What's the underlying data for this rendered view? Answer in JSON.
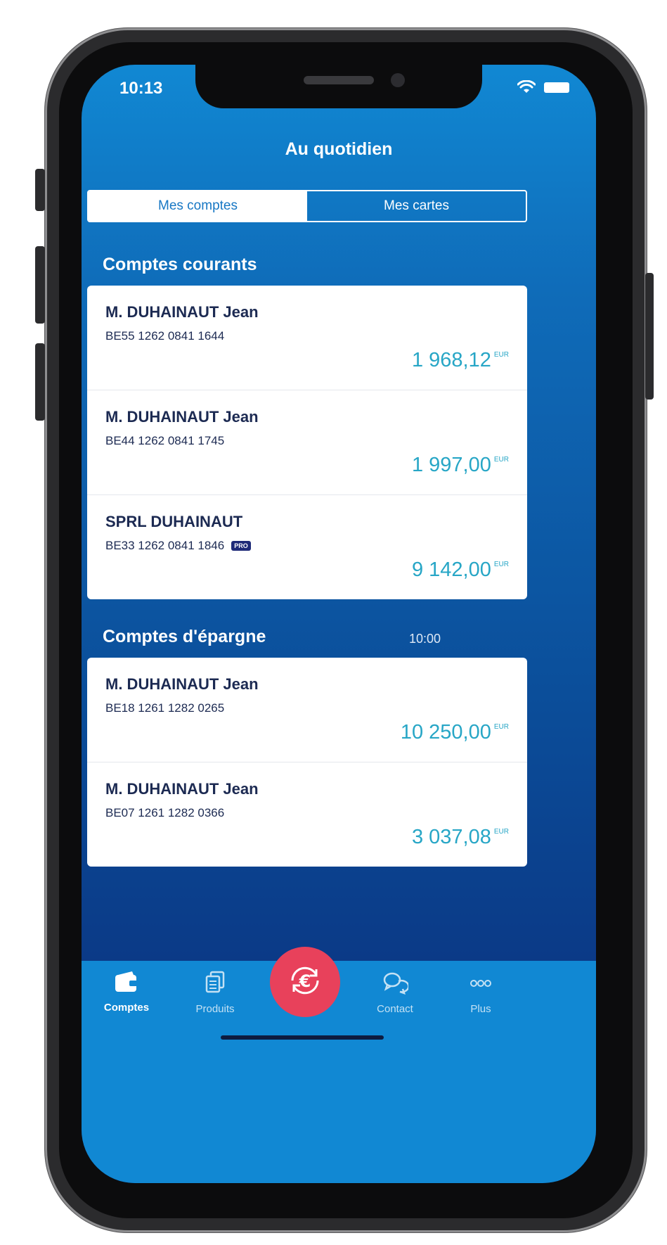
{
  "status_bar": {
    "time": "10:13"
  },
  "header": {
    "title": "Au quotidien"
  },
  "segmented": {
    "tab_comptes": "Mes comptes",
    "tab_cartes": "Mes cartes"
  },
  "sections": {
    "courants": {
      "title": "Comptes courants",
      "accounts": [
        {
          "name": "M. DUHAINAUT Jean",
          "iban": "BE55 1262 0841 1644",
          "amount": "1 968,12",
          "currency": "EUR"
        },
        {
          "name": "M. DUHAINAUT Jean",
          "iban": "BE44 1262 0841 1745",
          "amount": "1 997,00",
          "currency": "EUR"
        },
        {
          "name": "SPRL DUHAINAUT",
          "iban": "BE33 1262 0841 1846",
          "badge": "PRO",
          "amount": "9 142,00",
          "currency": "EUR"
        }
      ]
    },
    "epargne": {
      "title": "Comptes d'épargne",
      "time": "10:00",
      "accounts": [
        {
          "name": "M. DUHAINAUT Jean",
          "iban": "BE18 1261 1282 0265",
          "amount": "10 250,00",
          "currency": "EUR"
        },
        {
          "name": "M. DUHAINAUT Jean",
          "iban": "BE07 1261 1282 0366",
          "amount": "3 037,08",
          "currency": "EUR"
        }
      ]
    }
  },
  "tabbar": {
    "comptes": "Comptes",
    "produits": "Produits",
    "contact": "Contact",
    "plus": "Plus",
    "transfer_icon": "euro-transfer-icon"
  },
  "colors": {
    "accent_amount": "#27a6c6",
    "transfer_button": "#e8415b",
    "header_blue": "#1188d3"
  }
}
